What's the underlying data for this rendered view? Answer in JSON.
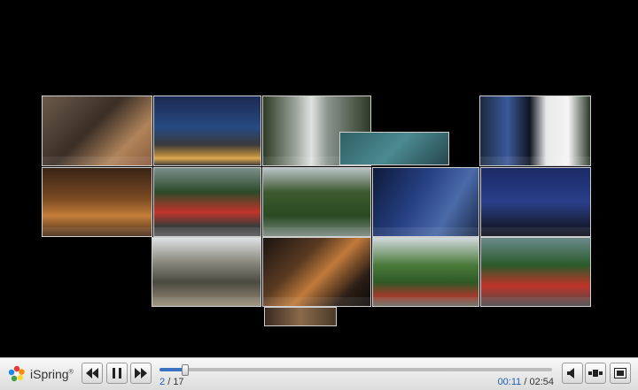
{
  "player": {
    "brand": "iSpring",
    "current_slide": "2",
    "separator": "/",
    "total_slides": "17",
    "current_time": "00:11",
    "time_separator": "/",
    "total_time": "02:54",
    "progress": 0.065
  },
  "colors": {
    "background": "#000000",
    "accent": "#3b73c4",
    "tile_border": "#cfcfcf"
  },
  "icons": {
    "prev": "skip-back-icon",
    "pause": "pause-icon",
    "next": "skip-forward-icon",
    "volume": "volume-icon",
    "layout": "layout-icon",
    "fullscreen": "fullscreen-icon"
  }
}
